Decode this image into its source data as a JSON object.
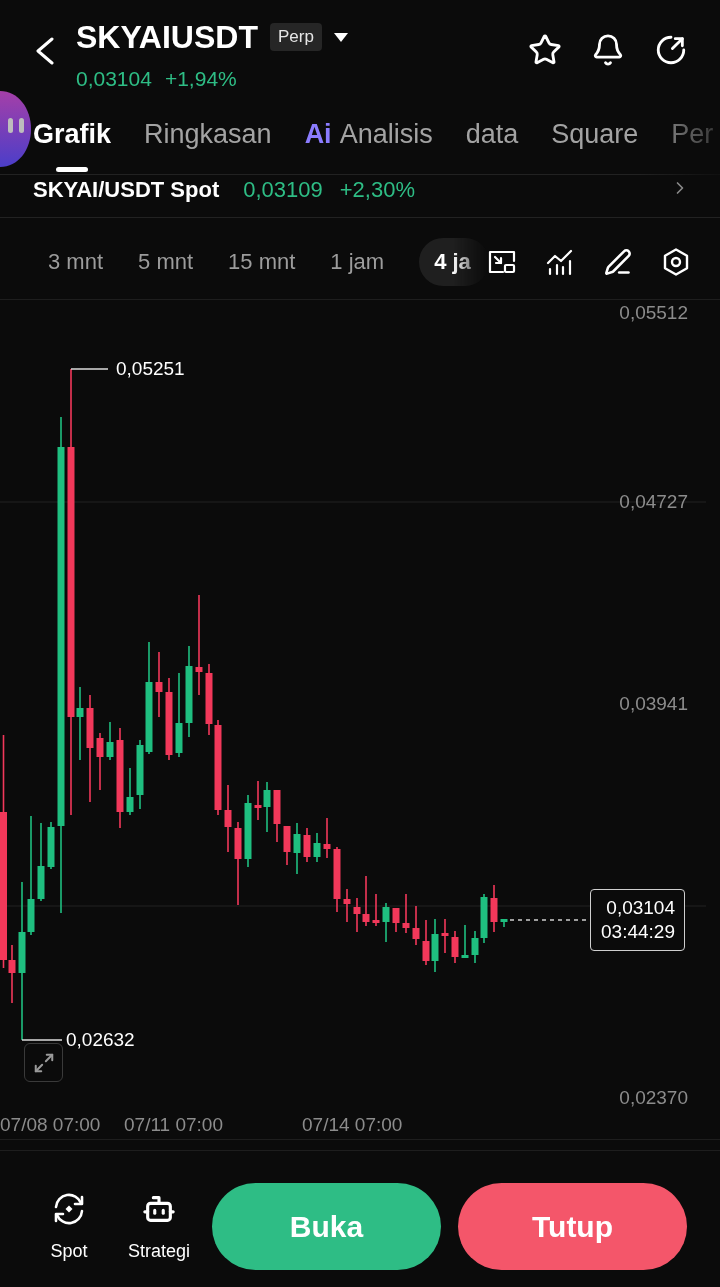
{
  "header": {
    "title": "SKYAIUSDT",
    "badge": "Perp",
    "price": "0,03104",
    "change": "+1,94%"
  },
  "tabs": [
    {
      "label": "Grafik",
      "selected": true
    },
    {
      "label": "Ringkasan",
      "selected": false
    },
    {
      "label": "Analisis",
      "prefix": "Ai",
      "selected": false
    },
    {
      "label": "data",
      "selected": false
    },
    {
      "label": "Square",
      "selected": false
    },
    {
      "label": "Per",
      "selected": false
    }
  ],
  "spot_market": {
    "pair": "SKYAI/USDT Spot",
    "price": "0,03109",
    "change": "+2,30%"
  },
  "intervals": [
    {
      "label": "3 mnt",
      "selected": false
    },
    {
      "label": "5 mnt",
      "selected": false
    },
    {
      "label": "15 mnt",
      "selected": false
    },
    {
      "label": "1 jam",
      "selected": false
    },
    {
      "label": "4 ja",
      "selected": true
    }
  ],
  "chart": {
    "y_axis_labels": [
      "0,05512",
      "0,04727",
      "0,03941",
      "0,02370"
    ],
    "x_axis_labels": [
      "07/08 07:00",
      "07/11 07:00",
      "07/14 07:00"
    ],
    "high_marker": "0,05251",
    "low_marker": "0,02632",
    "last_price": "0,03104",
    "countdown": "03:44:29"
  },
  "bottom_bar": {
    "shortcuts": [
      {
        "kind": "spot",
        "label": "Spot"
      },
      {
        "kind": "strategy",
        "label": "Strategi"
      }
    ],
    "actions": [
      {
        "kind": "buy",
        "label": "Buka"
      },
      {
        "kind": "sell",
        "label": "Tutup"
      }
    ]
  }
}
